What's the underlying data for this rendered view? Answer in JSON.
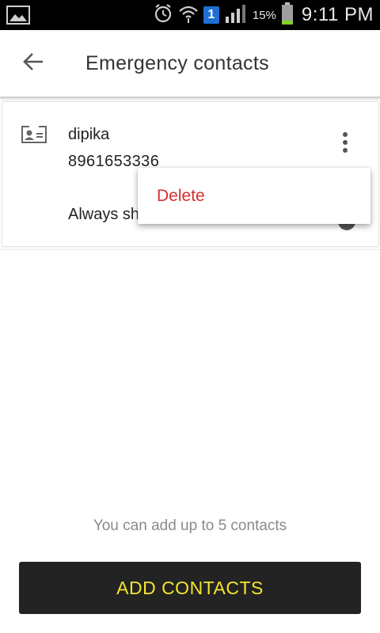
{
  "status_bar": {
    "battery_pct": "15%",
    "time": "9:11 PM",
    "notification_badge": "1",
    "icons": [
      "gallery-icon",
      "alarm-icon",
      "wifi-icon",
      "signal-icon",
      "battery-icon"
    ]
  },
  "header": {
    "title": "Emergency contacts",
    "back_icon": "arrow-back-icon"
  },
  "contact": {
    "name": "dipika",
    "phone": "8961653336",
    "status_text": "Always sh",
    "icon": "contact-card-icon",
    "menu_icon": "more-vert-icon"
  },
  "popup_menu": {
    "items": [
      {
        "label": "Delete",
        "color": "#d32f2f"
      }
    ]
  },
  "footer": {
    "limit_note": "You can add up to 5 contacts",
    "add_button_label": "ADD CONTACTS",
    "accent_color": "#f3e52b"
  }
}
